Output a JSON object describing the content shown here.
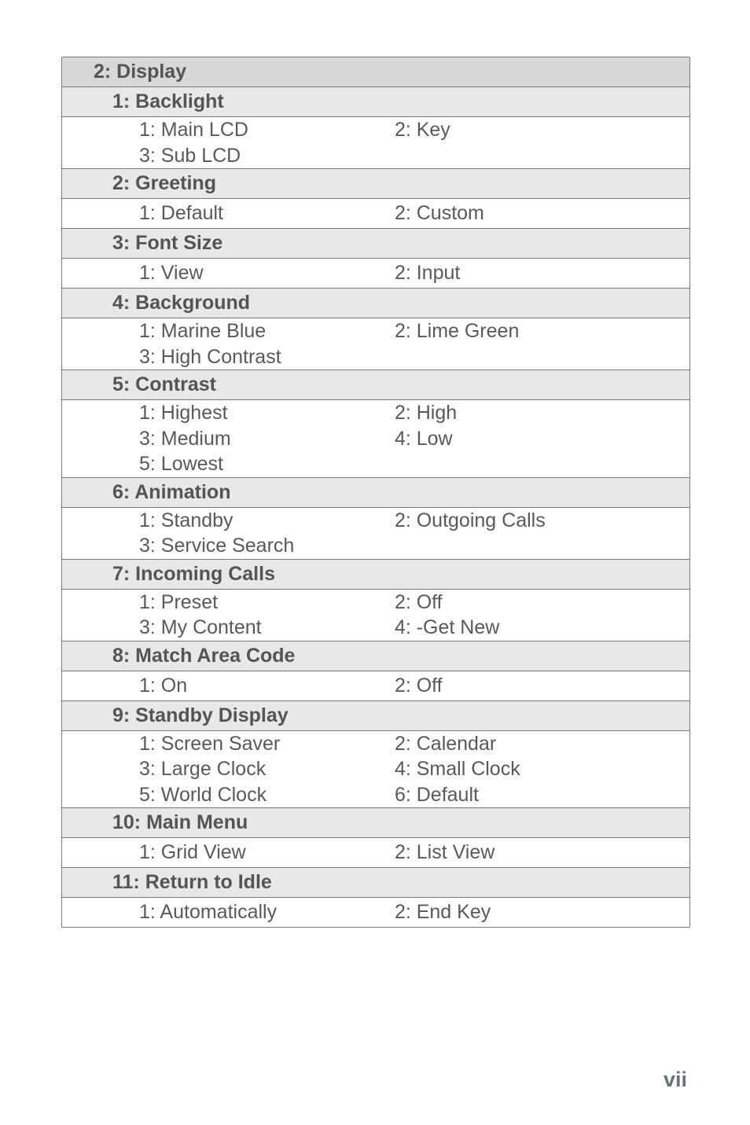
{
  "pageNumber": "vii",
  "menu": {
    "section": "2: Display",
    "groups": [
      {
        "title": "1: Backlight",
        "items": [
          [
            "1: Main LCD",
            "2: Key"
          ],
          [
            "3: Sub LCD",
            ""
          ]
        ]
      },
      {
        "title": "2: Greeting",
        "items": [
          [
            "1: Default",
            "2: Custom"
          ]
        ]
      },
      {
        "title": "3: Font Size",
        "items": [
          [
            "1: View",
            "2: Input"
          ]
        ]
      },
      {
        "title": "4: Background",
        "items": [
          [
            "1: Marine Blue",
            "2: Lime Green"
          ],
          [
            "3: High Contrast",
            ""
          ]
        ]
      },
      {
        "title": "5: Contrast",
        "items": [
          [
            "1: Highest",
            "2: High"
          ],
          [
            "3: Medium",
            "4: Low"
          ],
          [
            "5: Lowest",
            ""
          ]
        ]
      },
      {
        "title": "6: Animation",
        "items": [
          [
            "1: Standby",
            "2: Outgoing Calls"
          ],
          [
            "3: Service Search",
            ""
          ]
        ]
      },
      {
        "title": "7: Incoming Calls",
        "items": [
          [
            "1: Preset",
            "2: Off"
          ],
          [
            "3: My Content",
            "4: -Get New"
          ]
        ]
      },
      {
        "title": "8: Match Area Code",
        "items": [
          [
            "1: On",
            "2: Off"
          ]
        ]
      },
      {
        "title": "9: Standby Display",
        "items": [
          [
            "1: Screen Saver",
            "2: Calendar"
          ],
          [
            "3: Large Clock",
            "4: Small Clock"
          ],
          [
            "5: World Clock",
            "6: Default"
          ]
        ]
      },
      {
        "title": "10: Main Menu",
        "items": [
          [
            "1: Grid View",
            "2: List View"
          ]
        ]
      },
      {
        "title": "11: Return to Idle",
        "items": [
          [
            "1: Automatically",
            "2: End Key"
          ]
        ]
      }
    ]
  }
}
